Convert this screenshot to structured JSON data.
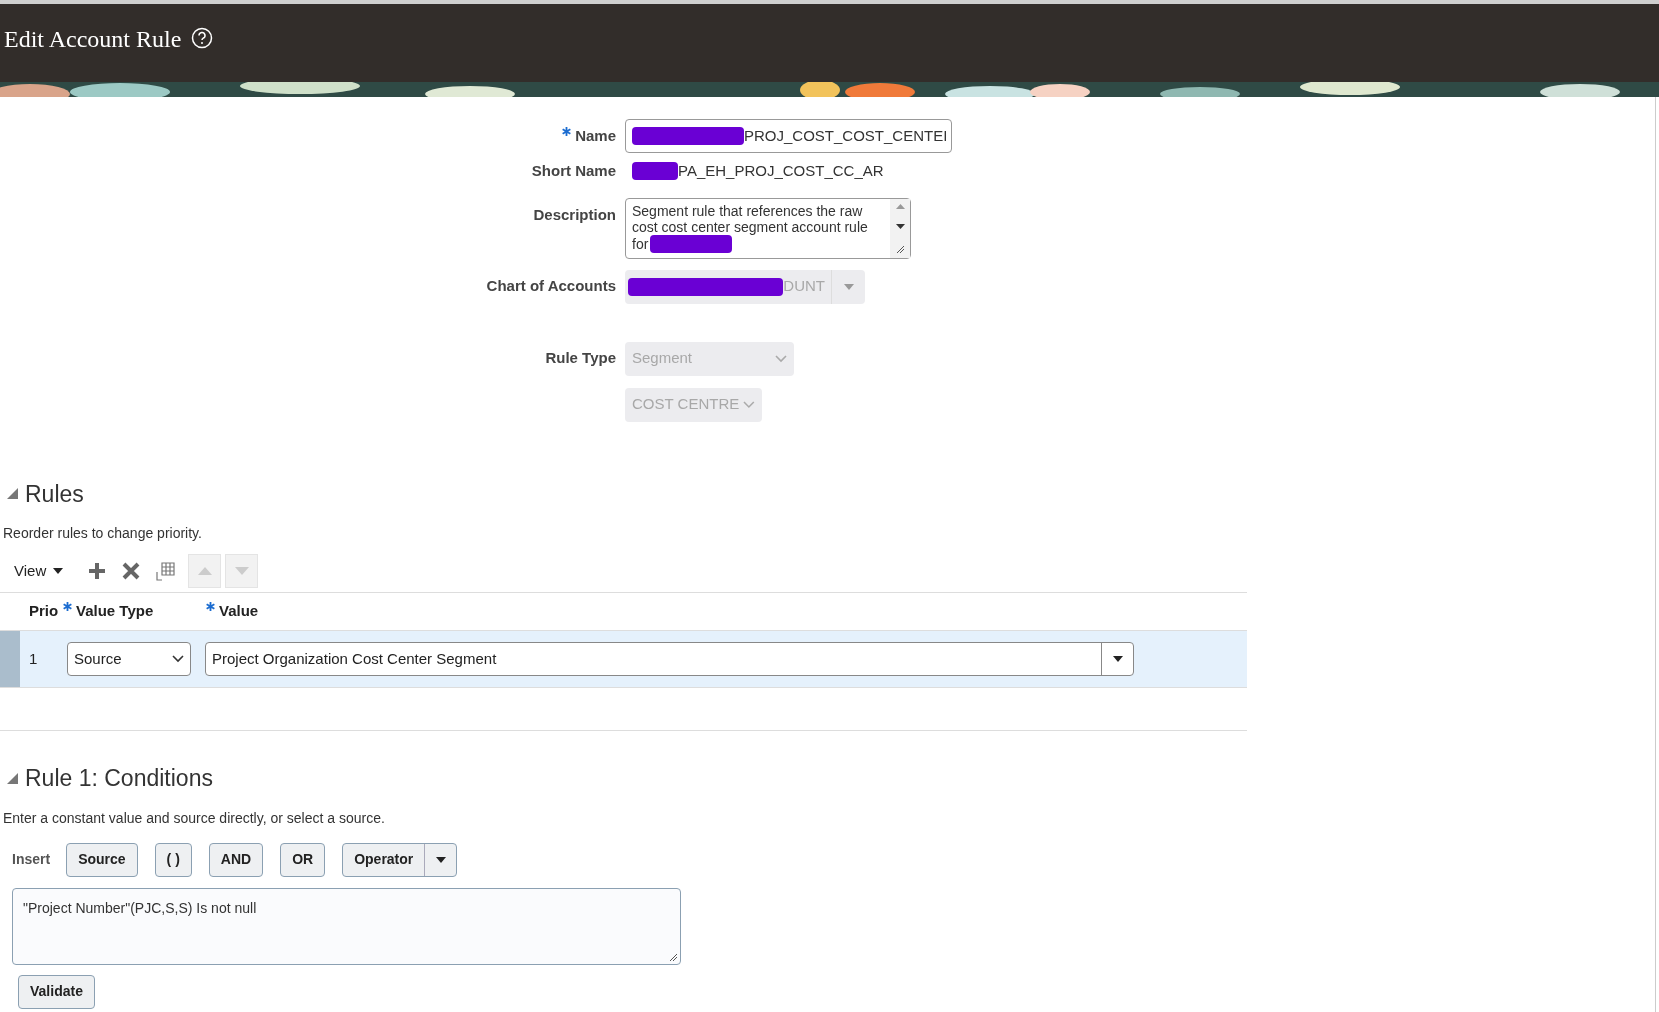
{
  "header": {
    "title": "Edit Account Rule"
  },
  "form": {
    "fields": [
      {
        "kind": "input",
        "label": "Name",
        "required": true,
        "redacted": true,
        "disabled": false,
        "value": "PROJ_COST_COST_CENTEI"
      },
      {
        "kind": "text",
        "label": "Short Name",
        "required": false,
        "redacted": true,
        "disabled": false,
        "value": "PA_EH_PROJ_COST_CC_AR"
      },
      {
        "kind": "textarea",
        "label": "Description",
        "required": false,
        "redacted": true,
        "disabled": false,
        "lines": [
          "Segment rule that references the raw",
          "cost cost center segment account rule",
          "for"
        ]
      },
      {
        "kind": "combo",
        "label": "Chart of Accounts",
        "required": false,
        "redacted": true,
        "disabled": true,
        "value": "DUNT"
      },
      {
        "kind": "select",
        "label": "Rule Type",
        "required": false,
        "redacted": false,
        "disabled": true,
        "value": "Segment"
      },
      {
        "kind": "select",
        "redacted": false,
        "disabled": true,
        "value": "COST CENTRE"
      }
    ]
  },
  "rules": {
    "title": "Rules",
    "expanded": true,
    "hint": "Reorder rules to change priority.",
    "view_label": "View",
    "columns": [
      {
        "label": "Prio",
        "required": false
      },
      {
        "label": "Value Type",
        "required": true
      },
      {
        "label": "Value",
        "required": true
      }
    ],
    "rows": [
      {
        "prio": "1",
        "value_type": "Source",
        "value": "Project Organization Cost Center Segment",
        "selected": true
      }
    ]
  },
  "conditions": {
    "title": "Rule 1: Conditions",
    "expanded": true,
    "hint": "Enter a constant value and source directly, or select a source.",
    "insert_label": "Insert",
    "buttons": [
      {
        "kind": "button",
        "label": "Source"
      },
      {
        "kind": "button",
        "label": "( )"
      },
      {
        "kind": "button",
        "label": "AND"
      },
      {
        "kind": "button",
        "label": "OR"
      },
      {
        "kind": "menu",
        "label": "Operator"
      }
    ],
    "expression": "\"Project Number\"(PJC,S,S) Is not null",
    "validate_label": "Validate"
  }
}
